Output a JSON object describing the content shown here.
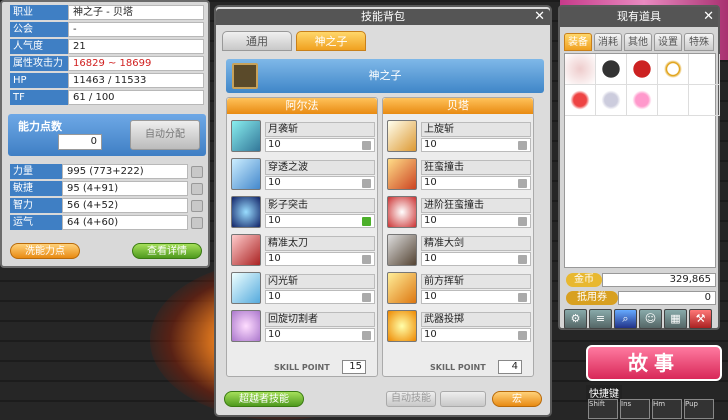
{
  "stat": {
    "rows": [
      {
        "label": "职业",
        "value": "神之子 - 贝塔"
      },
      {
        "label": "公会",
        "value": "-"
      },
      {
        "label": "人气度",
        "value": "21"
      },
      {
        "label": "属性攻击力",
        "value": "16829 ~ 18699"
      },
      {
        "label": "HP",
        "value": "11463 / 11533"
      },
      {
        "label": "TF",
        "value": "61 / 100"
      }
    ],
    "ap_label": "能力点数",
    "ap_value": "0",
    "auto_assign": "自动分配",
    "attrs": [
      {
        "label": "力量",
        "value": "995 (773+222)"
      },
      {
        "label": "敏捷",
        "value": "95 (4+91)"
      },
      {
        "label": "智力",
        "value": "56 (4+52)"
      },
      {
        "label": "运气",
        "value": "64 (4+60)"
      }
    ],
    "wash_btn": "洗能力点",
    "detail_btn": "查看详情"
  },
  "skill": {
    "title": "技能背包",
    "tabs": [
      "通用",
      "神之子"
    ],
    "active_tab": 1,
    "job": "神之子",
    "left": {
      "header": "阿尔法",
      "skills": [
        {
          "name": "月袭斩",
          "level": "10"
        },
        {
          "name": "穿透之波",
          "level": "10"
        },
        {
          "name": "影子突击",
          "level": "10"
        },
        {
          "name": "精准太刀",
          "level": "10"
        },
        {
          "name": "闪光斩",
          "level": "10"
        },
        {
          "name": "回旋切割者",
          "level": "10"
        }
      ],
      "skill_point_label": "SKILL POINT",
      "skill_point": "15"
    },
    "right": {
      "header": "贝塔",
      "skills": [
        {
          "name": "上旋斩",
          "level": "10"
        },
        {
          "name": "狂蛮撞击",
          "level": "10"
        },
        {
          "name": "进阶狂蛮撞击",
          "level": "10"
        },
        {
          "name": "精准大剑",
          "level": "10"
        },
        {
          "name": "前方挥斩",
          "level": "10"
        },
        {
          "name": "武器投掷",
          "level": "10"
        }
      ],
      "skill_point_label": "SKILL POINT",
      "skill_point": "4"
    },
    "hyper_btn": "超越者技能",
    "auto_btn": "自动技能",
    "macro_btn": "宏"
  },
  "inventory": {
    "title": "现有道具",
    "tabs": [
      "装备",
      "消耗",
      "其他",
      "设置",
      "特殊"
    ],
    "active_tab": 0,
    "meso_label": "金币",
    "meso": "329,865",
    "coupon_label": "抵用券",
    "coupon": "0"
  },
  "story_btn": "故事",
  "quick_label": "快捷键",
  "quick_keys": [
    "Shift",
    "Ins",
    "Hm",
    "Pup"
  ]
}
